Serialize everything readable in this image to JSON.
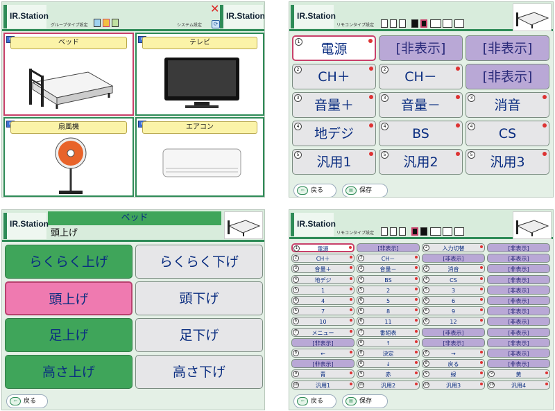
{
  "app": {
    "logo": "IR.Station"
  },
  "screen1": {
    "group_type_label": "グループタイプ設定",
    "system_label": "システム設定",
    "cards": [
      {
        "label": "ベッド",
        "icon": "bed-illustration"
      },
      {
        "label": "テレビ",
        "icon": "tv-illustration"
      },
      {
        "label": "扇風機",
        "icon": "fan-illustration"
      },
      {
        "label": "エアコン",
        "icon": "aircon-illustration"
      }
    ]
  },
  "screen2": {
    "remote_type_label": "リモコンタイプ設定",
    "rows": [
      [
        {
          "n": "1",
          "label": "電源",
          "style": "red"
        },
        {
          "n": "",
          "label": "[非表示]",
          "style": "hid"
        },
        {
          "n": "",
          "label": "[非表示]",
          "style": "hid"
        }
      ],
      [
        {
          "n": "2",
          "label": "CH＋",
          "style": ""
        },
        {
          "n": "2",
          "label": "CH－",
          "style": ""
        },
        {
          "n": "",
          "label": "[非表示]",
          "style": "hid"
        }
      ],
      [
        {
          "n": "3",
          "label": "音量＋",
          "style": ""
        },
        {
          "n": "3",
          "label": "音量－",
          "style": ""
        },
        {
          "n": "3",
          "label": "消音",
          "style": ""
        }
      ],
      [
        {
          "n": "4",
          "label": "地デジ",
          "style": ""
        },
        {
          "n": "4",
          "label": "BS",
          "style": ""
        },
        {
          "n": "4",
          "label": "CS",
          "style": ""
        }
      ],
      [
        {
          "n": "5",
          "label": "汎用1",
          "style": ""
        },
        {
          "n": "5",
          "label": "汎用2",
          "style": ""
        },
        {
          "n": "5",
          "label": "汎用3",
          "style": ""
        }
      ]
    ],
    "back_label": "戻る",
    "save_label": "保存"
  },
  "screen3": {
    "device_title": "ベッド",
    "sub_title": "頭上げ",
    "buttons": [
      {
        "label": "らくらく上げ",
        "style": "green"
      },
      {
        "label": "らくらく下げ",
        "style": ""
      },
      {
        "label": "頭上げ",
        "style": "pink"
      },
      {
        "label": "頭下げ",
        "style": ""
      },
      {
        "label": "足上げ",
        "style": "green"
      },
      {
        "label": "足下げ",
        "style": ""
      },
      {
        "label": "高さ上げ",
        "style": "green"
      },
      {
        "label": "高さ下げ",
        "style": ""
      }
    ],
    "back_label": "戻る"
  },
  "screen4": {
    "remote_type_label": "リモコンタイプ設定",
    "rows": [
      [
        {
          "n": "1",
          "label": "電源",
          "style": "red"
        },
        {
          "n": "",
          "label": "[非表示]",
          "style": "hid"
        },
        {
          "n": "2",
          "label": "入力切替",
          "style": ""
        },
        {
          "n": "",
          "label": "[非表示]",
          "style": "hid"
        }
      ],
      [
        {
          "n": "2",
          "label": "CH＋",
          "style": ""
        },
        {
          "n": "3",
          "label": "CH－",
          "style": ""
        },
        {
          "n": "",
          "label": "[非表示]",
          "style": "hid"
        },
        {
          "n": "",
          "label": "[非表示]",
          "style": "hid"
        }
      ],
      [
        {
          "n": "3",
          "label": "音量＋",
          "style": ""
        },
        {
          "n": "3",
          "label": "音量－",
          "style": ""
        },
        {
          "n": "3",
          "label": "消音",
          "style": ""
        },
        {
          "n": "",
          "label": "[非表示]",
          "style": "hid"
        }
      ],
      [
        {
          "n": "4",
          "label": "地デジ",
          "style": ""
        },
        {
          "n": "4",
          "label": "BS",
          "style": ""
        },
        {
          "n": "4",
          "label": "CS",
          "style": ""
        },
        {
          "n": "",
          "label": "[非表示]",
          "style": "hid"
        }
      ],
      [
        {
          "n": "5",
          "label": "1",
          "style": ""
        },
        {
          "n": "5",
          "label": "2",
          "style": ""
        },
        {
          "n": "5",
          "label": "3",
          "style": ""
        },
        {
          "n": "",
          "label": "[非表示]",
          "style": "hid"
        }
      ],
      [
        {
          "n": "6",
          "label": "4",
          "style": ""
        },
        {
          "n": "6",
          "label": "5",
          "style": ""
        },
        {
          "n": "6",
          "label": "6",
          "style": ""
        },
        {
          "n": "",
          "label": "[非表示]",
          "style": "hid"
        }
      ],
      [
        {
          "n": "6",
          "label": "7",
          "style": ""
        },
        {
          "n": "6",
          "label": "8",
          "style": ""
        },
        {
          "n": "6",
          "label": "9",
          "style": ""
        },
        {
          "n": "",
          "label": "[非表示]",
          "style": "hid"
        }
      ],
      [
        {
          "n": "6",
          "label": "10",
          "style": ""
        },
        {
          "n": "6",
          "label": "11",
          "style": ""
        },
        {
          "n": "6",
          "label": "12",
          "style": ""
        },
        {
          "n": "",
          "label": "[非表示]",
          "style": "hid"
        }
      ],
      [
        {
          "n": "7",
          "label": "メニュー",
          "style": ""
        },
        {
          "n": "7",
          "label": "番組表",
          "style": ""
        },
        {
          "n": "",
          "label": "[非表示]",
          "style": "hid"
        },
        {
          "n": "",
          "label": "[非表示]",
          "style": "hid"
        }
      ],
      [
        {
          "n": "",
          "label": "[非表示]",
          "style": "hid"
        },
        {
          "n": "8",
          "label": "↑",
          "style": ""
        },
        {
          "n": "",
          "label": "[非表示]",
          "style": "hid"
        },
        {
          "n": "",
          "label": "[非表示]",
          "style": "hid"
        }
      ],
      [
        {
          "n": "8",
          "label": "←",
          "style": ""
        },
        {
          "n": "8",
          "label": "決定",
          "style": ""
        },
        {
          "n": "8",
          "label": "→",
          "style": ""
        },
        {
          "n": "",
          "label": "[非表示]",
          "style": "hid"
        }
      ],
      [
        {
          "n": "",
          "label": "[非表示]",
          "style": "hid"
        },
        {
          "n": "8",
          "label": "↓",
          "style": ""
        },
        {
          "n": "8",
          "label": "戻る",
          "style": ""
        },
        {
          "n": "",
          "label": "[非表示]",
          "style": "hid"
        }
      ],
      [
        {
          "n": "9",
          "label": "青",
          "style": ""
        },
        {
          "n": "9",
          "label": "赤",
          "style": ""
        },
        {
          "n": "9",
          "label": "緑",
          "style": ""
        },
        {
          "n": "9",
          "label": "黄",
          "style": ""
        }
      ],
      [
        {
          "n": "10",
          "label": "汎用1",
          "style": ""
        },
        {
          "n": "10",
          "label": "汎用2",
          "style": ""
        },
        {
          "n": "10",
          "label": "汎用3",
          "style": ""
        },
        {
          "n": "10",
          "label": "汎用4",
          "style": ""
        }
      ]
    ],
    "back_label": "戻る",
    "save_label": "保存"
  }
}
